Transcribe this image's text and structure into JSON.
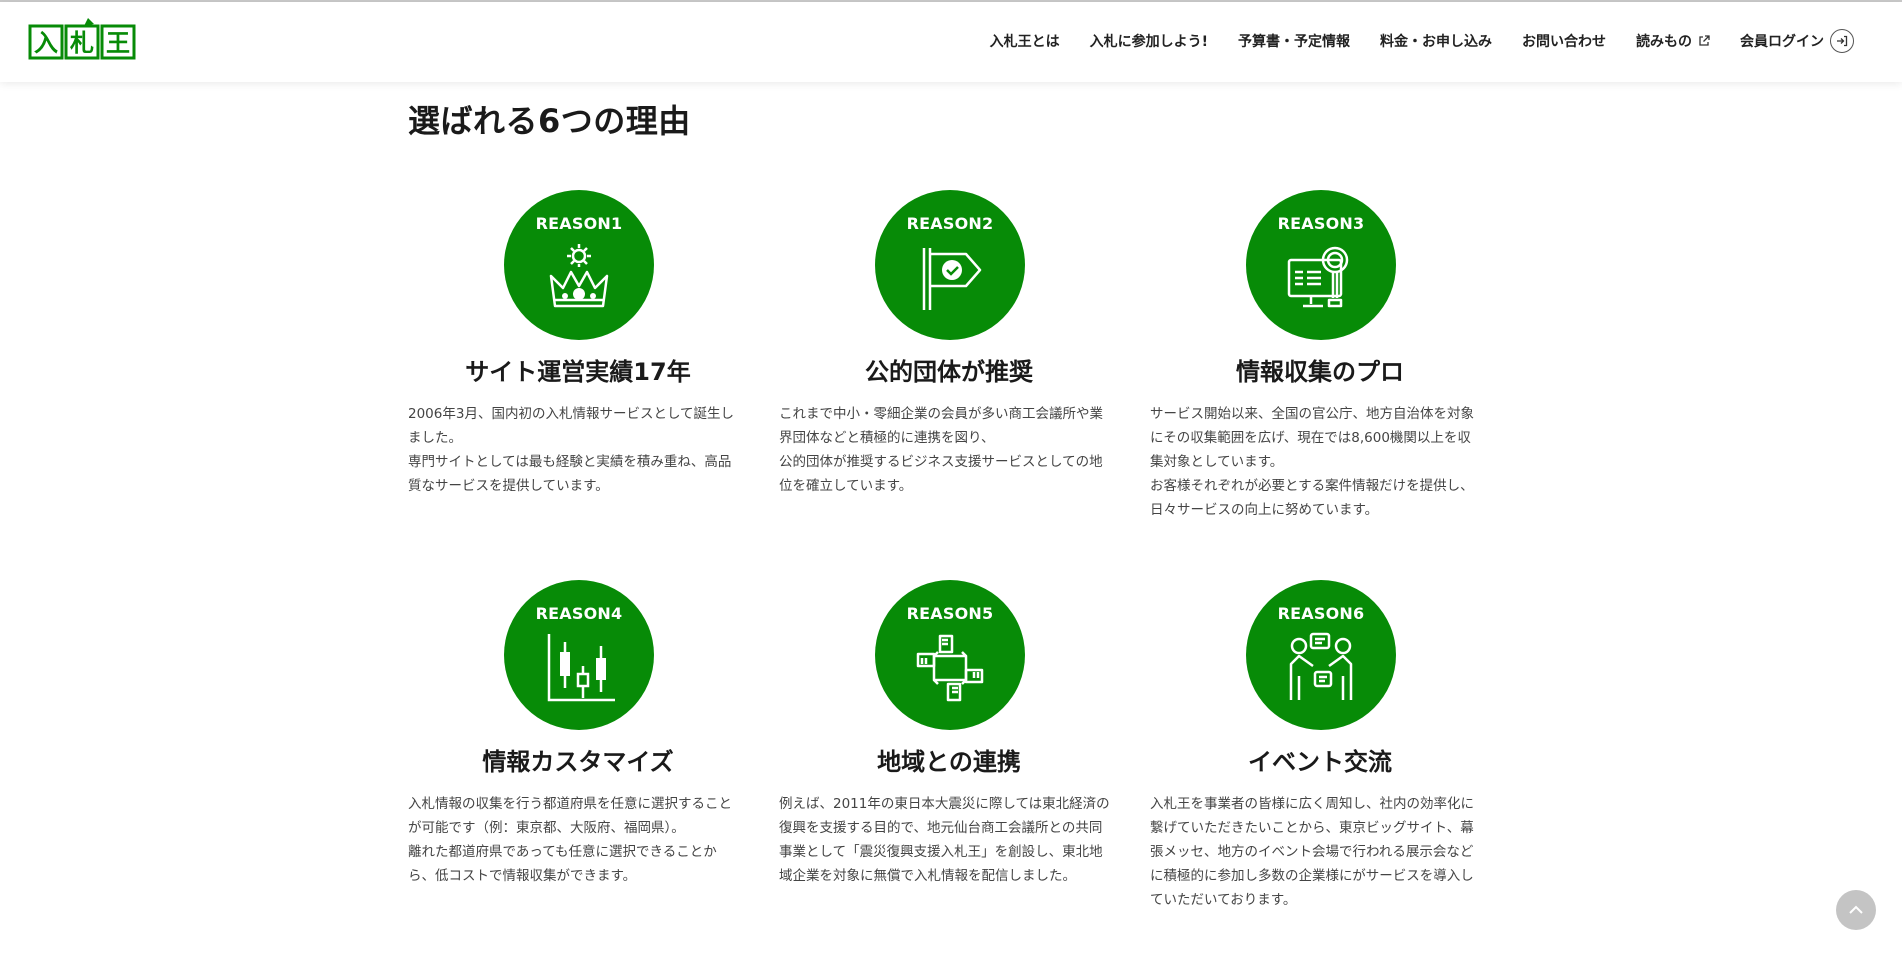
{
  "brand": {
    "logo_text": "入札王",
    "accent_color": "#078b07"
  },
  "nav": {
    "items": [
      {
        "label": "入札王とは"
      },
      {
        "label": "入札に参加しよう!"
      },
      {
        "label": "予算書・予定情報"
      },
      {
        "label": "料金・お申し込み"
      },
      {
        "label": "お問い合わせ"
      },
      {
        "label": "読みもの",
        "icon": "external-link-icon"
      },
      {
        "label": "会員ログイン",
        "icon": "login-icon"
      }
    ]
  },
  "section": {
    "title": "選ばれる6つの理由"
  },
  "reasons": [
    {
      "label": "REASON1",
      "icon": "crown-icon",
      "title": "サイト運営実績17年",
      "lines": [
        "2006年3月、国内初の入札情報サービスとして誕生し",
        "ました。",
        "専門サイトとしては最も経験と実績を積み重ね、高品",
        "質なサービスを提供しています。"
      ]
    },
    {
      "label": "REASON2",
      "icon": "flag-check-icon",
      "title": "公的団体が推奨",
      "lines": [
        "これまで中小・零細企業の会員が多い商工会議所や業",
        "界団体などと積極的に連携を図り、",
        "公的団体が推奨するビジネス支援サービスとしての地",
        "位を確立しています。"
      ]
    },
    {
      "label": "REASON3",
      "icon": "monitor-magnifier-icon",
      "title": "情報収集のプロ",
      "lines": [
        "サービス開始以来、全国の官公庁、地方自治体を対象",
        "にその収集範囲を広げ、現在では8,600機関以上を収",
        "集対象としています。",
        "お客様それぞれが必要とする案件情報だけを提供し、",
        "日々サービスの向上に努めています。"
      ]
    },
    {
      "label": "REASON4",
      "icon": "candlestick-chart-icon",
      "title": "情報カスタマイズ",
      "lines": [
        "入札情報の収集を行う都道府県を任意に選択すること",
        "が可能です（例：東京都、大阪府、福岡県）。",
        "離れた都道府県であっても任意に選択できることか",
        "ら、低コストで情報収集ができます。"
      ]
    },
    {
      "label": "REASON5",
      "icon": "joined-hands-icon",
      "title": "地域との連携",
      "lines": [
        "例えば、2011年の東日本大震災に際しては東北経済の",
        "復興を支援する目的で、地元仙台商工会議所との共同",
        "事業として「震災復興支援入札王」を創設し、東北地",
        "域企業を対象に無償で入札情報を配信しました。"
      ]
    },
    {
      "label": "REASON6",
      "icon": "people-conversation-icon",
      "title": "イベント交流",
      "lines": [
        "入札王を事業者の皆様に広く周知し、社内の効率化に",
        "繋げていただきたいことから、東京ビッグサイト、幕",
        "張メッセ、地方のイベント会場で行われる展示会など",
        "に積極的に参加し多数の企業様にがサービスを導入し",
        "ていただいております。"
      ]
    }
  ]
}
